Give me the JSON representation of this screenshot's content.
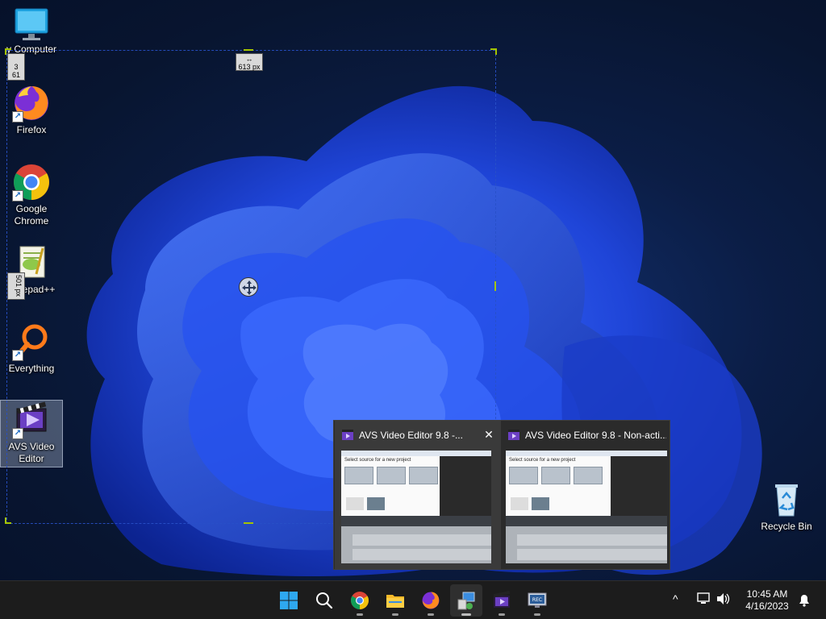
{
  "desktop": {
    "icons": [
      {
        "label": "My Computer",
        "icon": "computer-icon"
      },
      {
        "label": "Firefox",
        "icon": "firefox-icon"
      },
      {
        "label": "Google Chrome",
        "icon": "chrome-icon"
      },
      {
        "label": "Notepad++",
        "icon": "notepad-plus-plus-icon"
      },
      {
        "label": "Everything",
        "icon": "everything-search-icon"
      },
      {
        "label": "AVS Video Editor",
        "icon": "avs-video-editor-icon"
      },
      {
        "label": "Recycle Bin",
        "icon": "recycle-bin-icon"
      }
    ],
    "visible_labels": {
      "my_computer": "y Computer",
      "notepad": "epad++",
      "chrome_line1": "Google",
      "chrome_line2": "Chrome",
      "avs_line1": "AVS Video",
      "avs_line2": "Editor"
    }
  },
  "snip_overlay": {
    "width_label": "613 px",
    "width_arrow": "↔",
    "height_top_label_line1": "3",
    "height_top_label_line2": "61",
    "height_side_label": "501 px",
    "accent_color": "#a4c400"
  },
  "thumbnail_popup": {
    "items": [
      {
        "title": "AVS Video Editor 9.8 -...",
        "close": "✕"
      },
      {
        "title": "AVS Video Editor 9.8 - Non-acti..."
      }
    ],
    "preview": {
      "heading": "Select source for a new project"
    }
  },
  "taskbar": {
    "apps": [
      {
        "name": "Start",
        "icon": "windows-start-icon"
      },
      {
        "name": "Search",
        "icon": "search-icon"
      },
      {
        "name": "Google Chrome",
        "icon": "chrome-icon"
      },
      {
        "name": "File Explorer",
        "icon": "folder-icon"
      },
      {
        "name": "Firefox",
        "icon": "firefox-icon"
      },
      {
        "name": "AVS Video Editor setup",
        "icon": "installer-icon"
      },
      {
        "name": "AVS Video Editor",
        "icon": "avs-video-editor-icon"
      },
      {
        "name": "Screen recorder",
        "icon": "recorder-icon"
      }
    ],
    "tray": {
      "chevron": "^",
      "time": "10:45 AM",
      "date": "4/16/2023"
    }
  }
}
